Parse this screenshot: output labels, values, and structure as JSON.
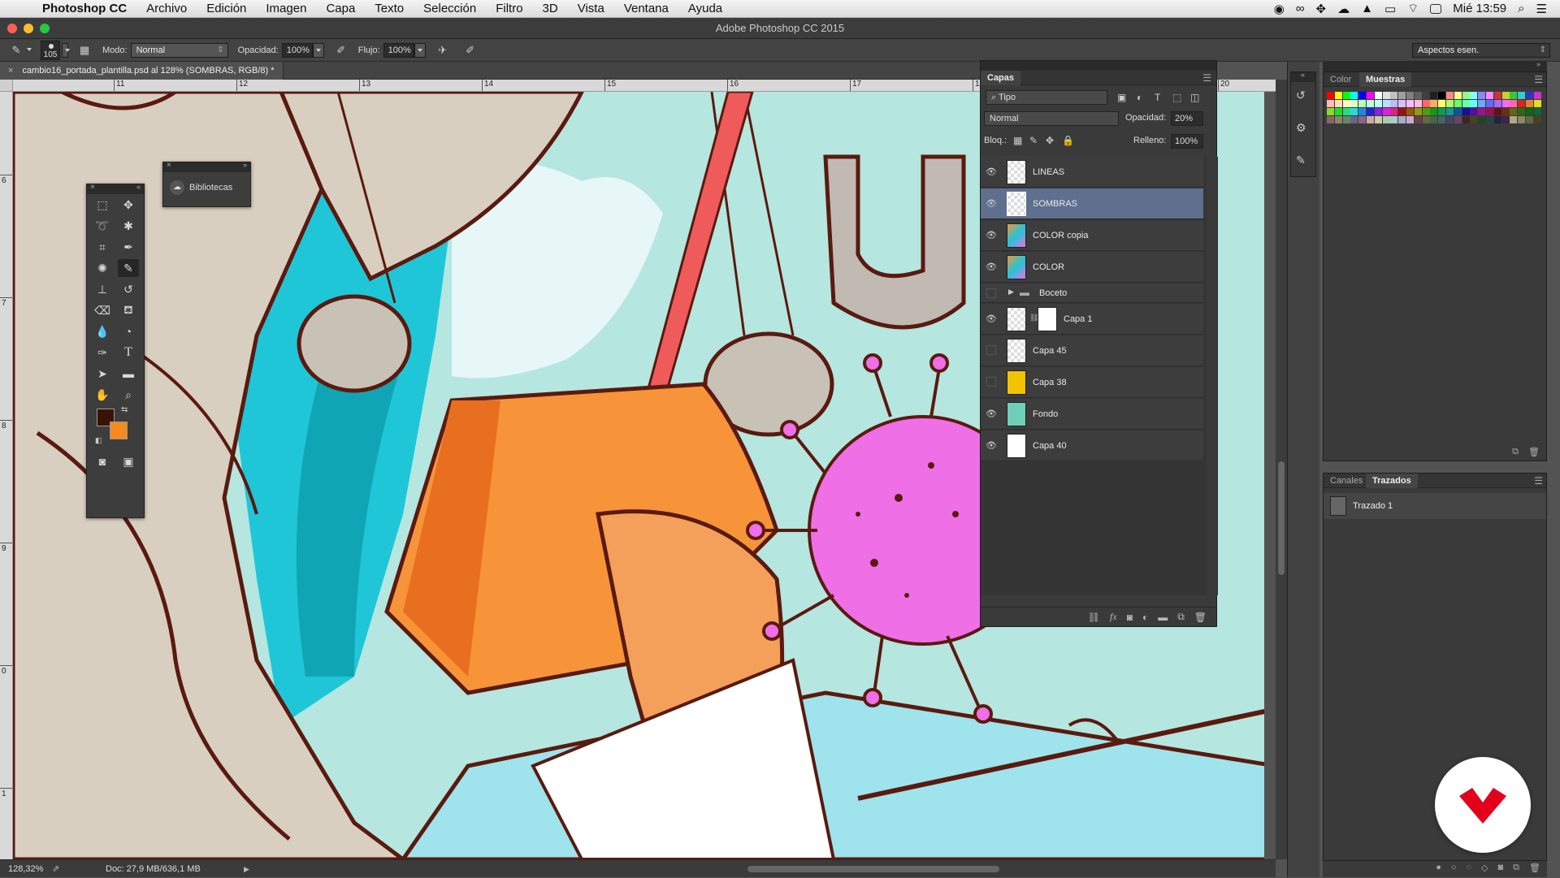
{
  "menubar": {
    "app_name": "Photoshop CC",
    "items": [
      "Archivo",
      "Edición",
      "Imagen",
      "Capa",
      "Texto",
      "Selección",
      "Filtro",
      "3D",
      "Vista",
      "Ventana",
      "Ayuda"
    ],
    "clock": "Mié 13:59",
    "status_icons": [
      "record-icon",
      "creative-cloud-icon",
      "dropbox-icon",
      "cloud-icon",
      "drive-icon",
      "airplay-icon",
      "wifi-icon",
      "battery-icon",
      "search-icon",
      "list-icon"
    ]
  },
  "window": {
    "title": "Adobe Photoshop CC 2015"
  },
  "options": {
    "brush_size": "105",
    "mode_label": "Modo:",
    "mode_value": "Normal",
    "opacity_label": "Opacidad:",
    "opacity_value": "100%",
    "flow_label": "Flujo:",
    "flow_value": "100%",
    "workspace": "Aspectos esen."
  },
  "document": {
    "tab_title": "cambio16_portada_plantilla.psd al 128% (SOMBRAS, RGB/8) *",
    "ruler_h": [
      "11",
      "12",
      "13",
      "14",
      "15",
      "16",
      "17",
      "18",
      "19",
      "20"
    ],
    "ruler_v": [
      "6",
      "7",
      "8",
      "9",
      "0",
      "1"
    ]
  },
  "status": {
    "zoom": "128,32%",
    "doc_info": "Doc: 27,9 MB/636,1 MB"
  },
  "libraries": {
    "label": "Bibliotecas"
  },
  "layers_panel": {
    "tab": "Capas",
    "filter": "Tipo",
    "blend_mode": "Normal",
    "opacity_label": "Opacidad:",
    "opacity_value": "20%",
    "lock_label": "Bloq.:",
    "fill_label": "Relleno:",
    "fill_value": "100%",
    "layers": [
      {
        "name": "LINEAS",
        "visible": true,
        "selected": false,
        "thumb": "checker"
      },
      {
        "name": "SOMBRAS",
        "visible": true,
        "selected": true,
        "thumb": "checker"
      },
      {
        "name": "COLOR copia",
        "visible": true,
        "selected": false,
        "thumb": "color"
      },
      {
        "name": "COLOR",
        "visible": true,
        "selected": false,
        "thumb": "color"
      },
      {
        "name": "Boceto",
        "visible": false,
        "selected": false,
        "thumb": "folder"
      },
      {
        "name": "Capa 1",
        "visible": true,
        "selected": false,
        "thumb": "mask"
      },
      {
        "name": "Capa 45",
        "visible": false,
        "selected": false,
        "thumb": "checker"
      },
      {
        "name": "Capa 38",
        "visible": false,
        "selected": false,
        "thumb": "#f2c300"
      },
      {
        "name": "Fondo",
        "visible": true,
        "selected": false,
        "thumb": "#6fcfb8"
      },
      {
        "name": "Capa 40",
        "visible": true,
        "selected": false,
        "thumb": "#ffffff"
      }
    ]
  },
  "swatches_panel": {
    "tabs": [
      "Color",
      "Muestras"
    ],
    "active": "Muestras"
  },
  "paths_panel": {
    "tabs": [
      "Canales",
      "Trazados"
    ],
    "active": "Trazados",
    "items": [
      "Trazado 1"
    ]
  },
  "colors": {
    "foreground": "#3a1205",
    "background": "#f58a1f",
    "selection": "#5f6f8e",
    "logo_red": "#e3001b"
  }
}
